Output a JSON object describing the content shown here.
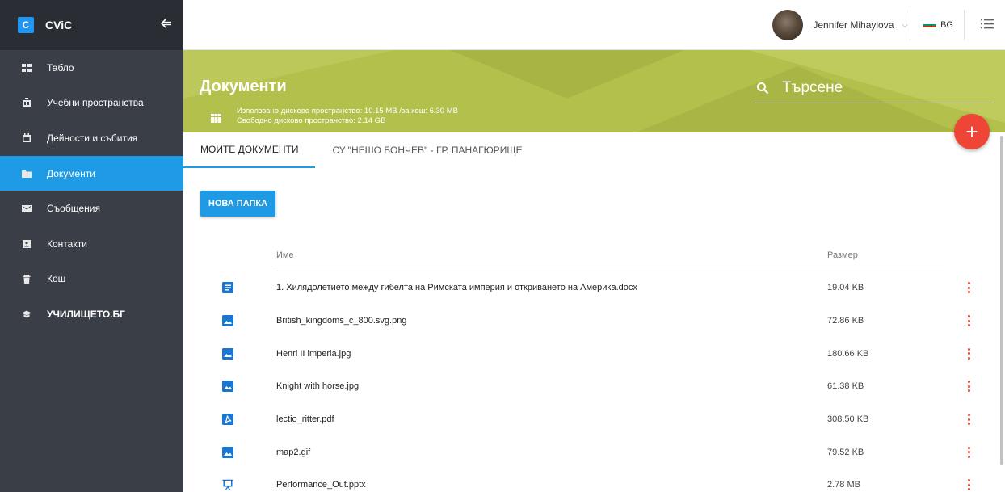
{
  "brand": {
    "logo_letter": "C",
    "name": "CViC",
    "collapse_icon": "collapse-arrow-icon"
  },
  "sidebar": {
    "items": [
      {
        "label": "Табло",
        "icon": "dashboard-icon",
        "active": false
      },
      {
        "label": "Учебни пространства",
        "icon": "classroom-icon",
        "active": false
      },
      {
        "label": "Дейности и събития",
        "icon": "calendar-icon",
        "active": false
      },
      {
        "label": "Документи",
        "icon": "folder-icon",
        "active": true
      },
      {
        "label": "Съобщения",
        "icon": "mail-icon",
        "active": false
      },
      {
        "label": "Контакти",
        "icon": "contacts-icon",
        "active": false
      },
      {
        "label": "Кош",
        "icon": "trash-icon",
        "active": false
      },
      {
        "label": "УЧИЛИЩЕТО.БГ",
        "icon": "graduation-cap-icon",
        "active": false
      }
    ]
  },
  "topbar": {
    "user_name": "Jennifer Mihaylova",
    "caret": "⌵",
    "language": "BG",
    "menu_icon": "list-menu-icon"
  },
  "hero": {
    "title": "Документи",
    "used_space": "Използвано дисково пространство: 10.15 MB /за кош: 6.30 MB",
    "free_space": "Свободно дисково пространство: 2.14 GB",
    "search_placeholder": "Търсене"
  },
  "fab": {
    "label": "+"
  },
  "tabs": [
    {
      "label": "МОИТЕ ДОКУМЕНТИ",
      "active": true
    },
    {
      "label": "СУ \"НЕШО БОНЧЕВ\" - ГР. ПАНАГЮРИЩЕ",
      "active": false
    }
  ],
  "actions": {
    "new_folder": "НОВА ПАПКА"
  },
  "table": {
    "columns": {
      "name": "Име",
      "size": "Размер"
    },
    "rows": [
      {
        "type": "document",
        "name": "1. Хилядолетието между гибелта на Римската империя и откриването на Америка.docx",
        "size": "19.04 KB"
      },
      {
        "type": "image",
        "name": "British_kingdoms_c_800.svg.png",
        "size": "72.86 KB"
      },
      {
        "type": "image",
        "name": "Henri II imperia.jpg",
        "size": "180.66 KB"
      },
      {
        "type": "image",
        "name": "Knight with horse.jpg",
        "size": "61.38 KB"
      },
      {
        "type": "pdf",
        "name": "lectio_ritter.pdf",
        "size": "308.50 KB"
      },
      {
        "type": "image",
        "name": "map2.gif",
        "size": "79.52 KB"
      },
      {
        "type": "presentation",
        "name": "Performance_Out.pptx",
        "size": "2.78 MB"
      }
    ]
  },
  "colors": {
    "sidebar_bg": "#3a3e47",
    "brand_bg": "#2a2d34",
    "accent": "#1e9be4",
    "hero_bg": "#b3c04c",
    "fab": "#ef4536",
    "kebab": "#e0442f",
    "file_icon": "#1976d2"
  }
}
